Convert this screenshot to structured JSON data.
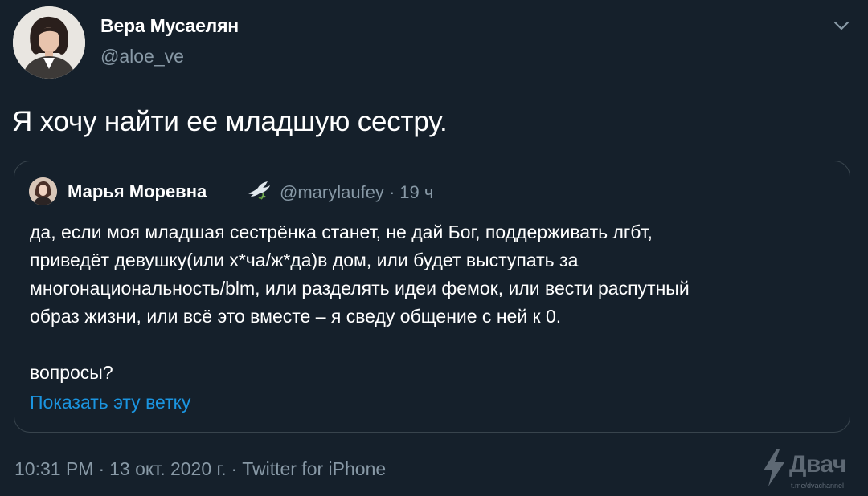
{
  "author": {
    "name": "Вера Мусаелян",
    "handle": "@aloe_ve"
  },
  "tweet": {
    "text": "Я хочу найти ее младшую сестру."
  },
  "quoted": {
    "name": "Марья Моревна",
    "name_emoji": "dove-icon",
    "handle": "@marylaufey",
    "separator": "·",
    "time": "19 ч",
    "body_lines": [
      "да, если моя младшая сестрёнка станет, не дай Бог, поддерживать лгбт,",
      "приведёт девушку(или х*ча/ж*да)в дом, или будет выступать за",
      "многонациональность/blm, или разделять идеи фемок, или вести распутный",
      "образ жизни, или всё это вместе – я сведу общение с ней к 0."
    ],
    "body_last": "вопросы?",
    "show_thread": "Показать эту ветку"
  },
  "footer": {
    "time": "10:31 PM",
    "separator": "·",
    "date": "13 окт. 2020 г.",
    "source": "Twitter for iPhone"
  },
  "watermark": {
    "brand": "Двач",
    "url": "t.me/dvachannel"
  },
  "colors": {
    "background": "#15202b",
    "text_primary": "#ffffff",
    "text_secondary": "#8899a6",
    "link": "#1b95e0",
    "border": "#38444d"
  }
}
